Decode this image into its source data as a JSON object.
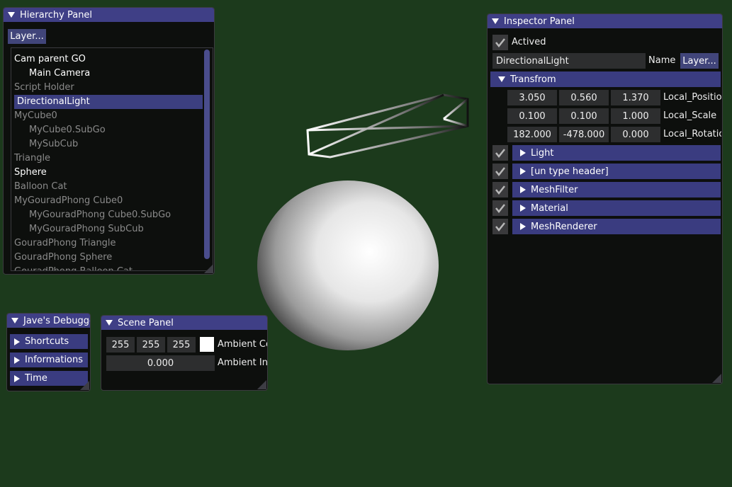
{
  "hierarchy": {
    "title": "Hierarchy Panel",
    "layer_button": "Layer...",
    "items": [
      {
        "label": "Cam parent GO",
        "state": "on"
      },
      {
        "label": "Main Camera",
        "state": "on"
      },
      {
        "label": "Script Holder",
        "state": "off"
      },
      {
        "label": "DirectionalLight",
        "state": "selected"
      },
      {
        "label": "MyCube0",
        "state": "off"
      },
      {
        "label": "MyCube0.SubGo",
        "state": "off"
      },
      {
        "label": "MySubCub",
        "state": "off"
      },
      {
        "label": "Triangle",
        "state": "off"
      },
      {
        "label": "Sphere",
        "state": "on"
      },
      {
        "label": "Balloon Cat",
        "state": "off"
      },
      {
        "label": "MyGouradPhong Cube0",
        "state": "off"
      },
      {
        "label": "MyGouradPhong Cube0.SubGo",
        "state": "off"
      },
      {
        "label": "MyGouradPhong SubCub",
        "state": "off"
      },
      {
        "label": "GouradPhong Triangle",
        "state": "off"
      },
      {
        "label": "GouradPhong Sphere",
        "state": "off"
      },
      {
        "label": "GouradPhong Balloon Cat",
        "state": "off"
      }
    ]
  },
  "debugger": {
    "title": "Jave's Debugger",
    "buttons": [
      "Shortcuts",
      "Informations",
      "Time"
    ]
  },
  "scene": {
    "title": "Scene Panel",
    "ambient_color": {
      "r": "255",
      "g": "255",
      "b": "255",
      "label": "Ambient Color"
    },
    "ambient_intensity": {
      "value": "0.000",
      "label": "Ambient Intensity"
    }
  },
  "inspector": {
    "title": "Inspector Panel",
    "actived_label": "Actived",
    "name_value": "DirectionalLight",
    "name_label": "Name",
    "layer_button": "Layer...",
    "transform": {
      "title": "Transfrom",
      "rows": [
        {
          "values": [
            "3.050",
            "0.560",
            "1.370"
          ],
          "label": "Local_Position"
        },
        {
          "values": [
            "0.100",
            "0.100",
            "1.000"
          ],
          "label": "Local_Scale"
        },
        {
          "values": [
            "182.000",
            "-478.000",
            "0.000"
          ],
          "label": "Local_Rotation"
        }
      ]
    },
    "components": [
      "Light",
      "[un type header]",
      "MeshFilter",
      "Material",
      "MeshRenderer"
    ]
  },
  "colors": {
    "background": "#1c3a1c",
    "title_bar": "#3f3f86",
    "panel_bg": "#0d0f0d",
    "selected": "#3c3f80"
  }
}
